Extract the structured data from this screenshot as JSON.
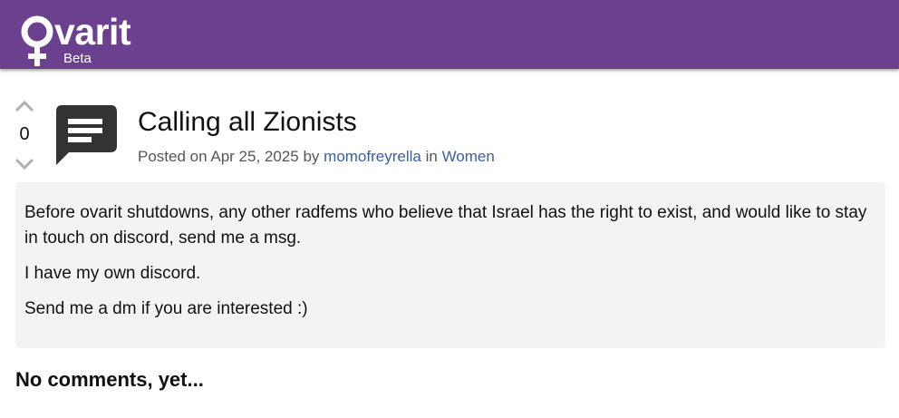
{
  "header": {
    "brand": "varit",
    "brand_sub": "Beta",
    "color": "#6b408e"
  },
  "post": {
    "vote_count": "0",
    "title": "Calling all Zionists",
    "meta": {
      "posted_on_label": "Posted on",
      "date": "Apr 25, 2025",
      "by_label": "by",
      "author": "momofreyrella",
      "in_label": "in",
      "community": "Women"
    },
    "body": [
      "Before ovarit shutdowns, any other radfems who believe that Israel has the right to exist, and would like to stay in touch on discord, send me a msg.",
      "I have my own discord.",
      "Send me a dm if you are interested :)"
    ],
    "icon": "speech-bubble-icon"
  },
  "comments": {
    "heading": "No comments, yet..."
  },
  "colors": {
    "link": "#3a5f9a",
    "body_bg": "#f3f3f3"
  }
}
